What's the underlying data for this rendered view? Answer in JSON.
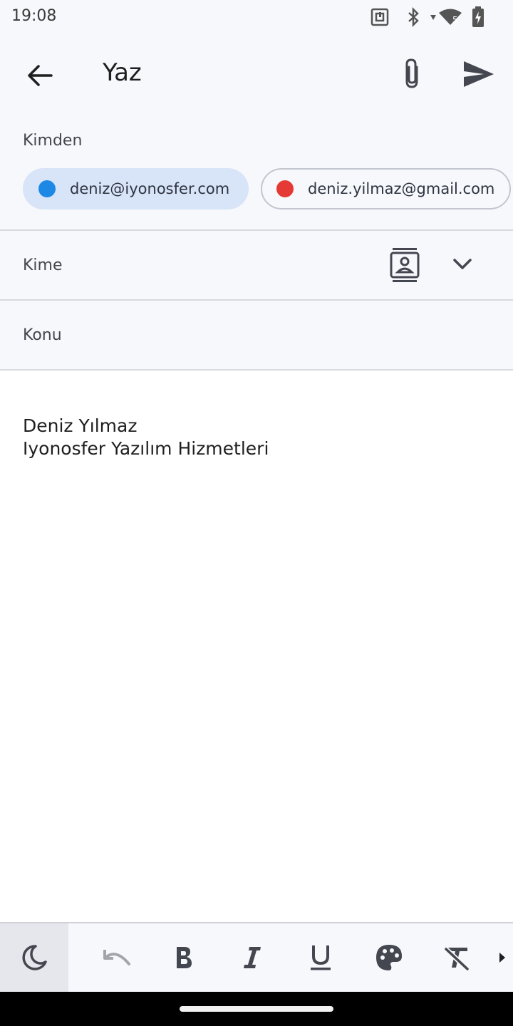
{
  "status_bar": {
    "time": "19:08",
    "icons": [
      "nfc-icon",
      "bluetooth-icon",
      "wifi-icon",
      "battery-icon"
    ],
    "wifi_badge": "5"
  },
  "app_bar": {
    "title": "Yaz",
    "icons": [
      "back-arrow-icon",
      "paperclip-icon",
      "send-icon"
    ]
  },
  "from": {
    "label": "Kimden",
    "accounts": [
      {
        "email": "deniz@iyonosfer.com",
        "color": "#1e88e5",
        "selected": true
      },
      {
        "email": "deniz.yilmaz@gmail.com",
        "color": "#e53935",
        "selected": false
      }
    ]
  },
  "to": {
    "label": "Kime"
  },
  "subject": {
    "label": "Konu"
  },
  "body": {
    "signature_line1": "Deniz Yılmaz",
    "signature_line2": "Iyonosfer Yazılım Hizmetleri"
  },
  "toolbar": {
    "tools": [
      "dark-mode-icon",
      "undo-icon",
      "bold-icon",
      "italic-icon",
      "underline-icon",
      "palette-icon",
      "clear-format-icon",
      "more-arrow-icon"
    ]
  },
  "colors": {
    "background": "#f7f8fc",
    "chip_selected": "#d8e4f8",
    "text": "#1f1f1f"
  }
}
